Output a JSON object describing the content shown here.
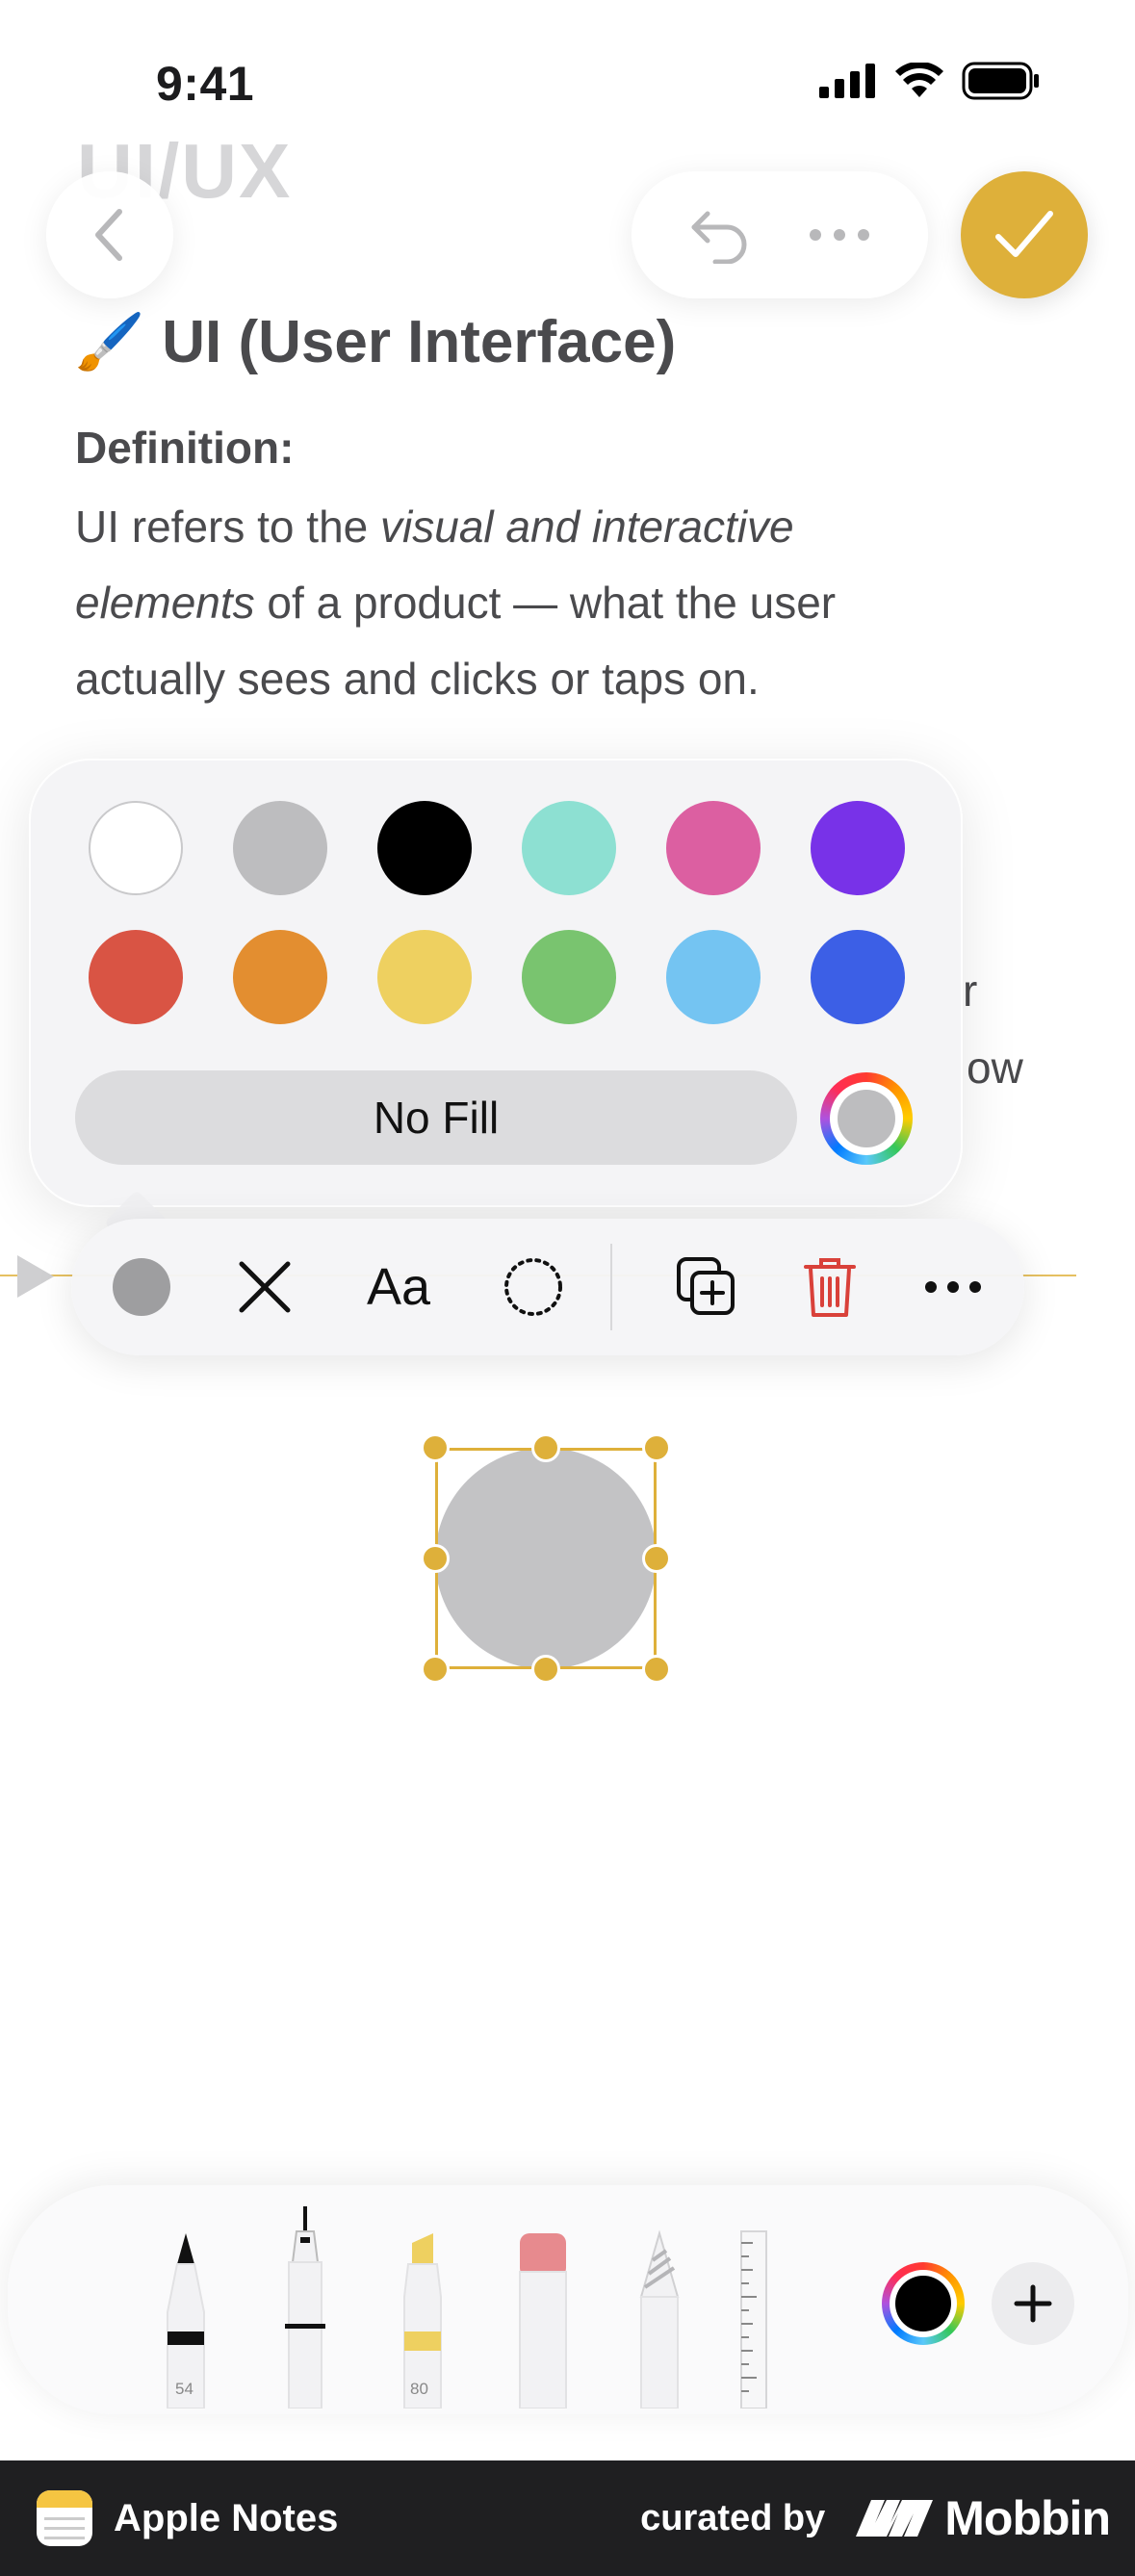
{
  "status_bar": {
    "time": "9:41"
  },
  "note": {
    "ghost_title": "UI/UX",
    "heading_emoji": "🖌️",
    "heading": "UI (User Interface)",
    "definition_label": "Definition:",
    "body_part1": "UI refers to the ",
    "body_italic1": "visual and interactive",
    "body_italic2": "elements",
    "body_part2": " of a product — what the user",
    "body_line3": "actually sees and clicks or taps on.",
    "peek_r": "r",
    "peek_ow": "ow"
  },
  "color_popover": {
    "swatches_row1": [
      "#ffffff",
      "#bdbdbf",
      "#000000",
      "#8de0d2",
      "#dc5fa1",
      "#7832e8"
    ],
    "swatches_row2": [
      "#d95444",
      "#e38e30",
      "#eed060",
      "#79c46f",
      "#74c4f2",
      "#3c5fe6"
    ],
    "no_fill_label": "No Fill"
  },
  "shape_toolbar": {
    "fill_swatch_color": "#9e9ea0",
    "text_style_label": "Aa",
    "accent_color": "#deb03a",
    "delete_color": "#d9413a"
  },
  "tools": {
    "pen_label": "54",
    "marker_label": "80",
    "current_color": "#000000"
  },
  "footer": {
    "app_name": "Apple Notes",
    "curated_by": "curated by",
    "brand": "Mobbin"
  }
}
